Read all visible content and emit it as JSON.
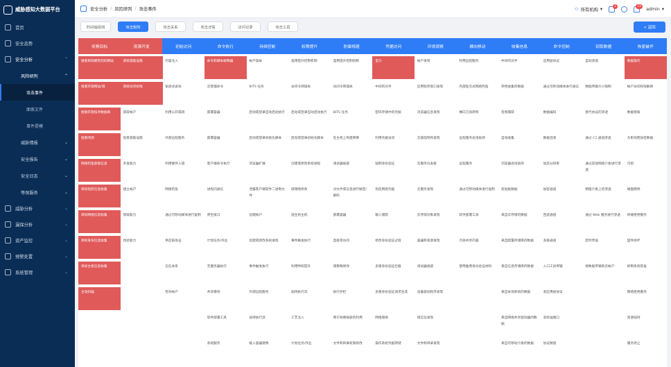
{
  "app": {
    "title": "威胁感知大数据平台"
  },
  "sidebar": {
    "items": [
      {
        "label": "首页"
      },
      {
        "label": "安全态势"
      },
      {
        "label": "安全分析"
      }
    ],
    "sub_open": {
      "label": "风险研判"
    },
    "sub_items": [
      {
        "label": "攻击事件"
      },
      {
        "label": "面索文件"
      },
      {
        "label": "事件提模"
      }
    ],
    "more": [
      {
        "label": "威胁情报"
      },
      {
        "label": "安全报告"
      },
      {
        "label": "安全日志"
      },
      {
        "label": "等保服务"
      }
    ],
    "bottom": [
      {
        "label": "威胁分析"
      },
      {
        "label": "漏保分析"
      },
      {
        "label": "资产监控"
      },
      {
        "label": "预警处置"
      },
      {
        "label": "系统管理"
      }
    ]
  },
  "topbar": {
    "breadcrumb": [
      "安全分析",
      "风险研判",
      "攻击事件"
    ],
    "org": "所有机构",
    "badge1": "2",
    "badge2": "15",
    "user": "admin"
  },
  "tabs": [
    {
      "label": "时间轴视测"
    },
    {
      "label": "攻击矩阵"
    },
    {
      "label": "攻击关系"
    },
    {
      "label": "攻击详情"
    },
    {
      "label": "访问记录"
    },
    {
      "label": "攻击工具"
    }
  ],
  "back_label": "< 返回",
  "matrix": {
    "columns": [
      {
        "header": "侦察目标",
        "hcolor": "#e05a5a",
        "cells": [
          {
            "t": "搜索目标拥有的的网站",
            "h": true
          },
          {
            "t": "搜索开放网站/域",
            "h": true
          },
          {
            "t": "搜索开放技术数据库",
            "h": true
          },
          {
            "t": "搜索闭源",
            "h": true
          },
          {
            "t": "网络钓鱼获取信息",
            "h": true
          },
          {
            "t": "目标组织信息收集",
            "h": true
          },
          {
            "t": "目标网络信息收集",
            "h": true
          },
          {
            "t": "目标身份信息收集",
            "h": true
          },
          {
            "t": "目标主机信息收集",
            "h": true
          },
          {
            "t": "主动扫描",
            "h": true
          }
        ]
      },
      {
        "header": "资源开发",
        "hcolor": "#e05a5a",
        "cells": [
          {
            "t": "获取基础设施",
            "h": true
          },
          {
            "t": "获取访问权限",
            "h": true
          },
          {
            "t": "获取帐户",
            "h": false
          },
          {
            "t": "危害基础设施",
            "h": false
          },
          {
            "t": "开发能力",
            "h": false
          },
          {
            "t": "建立帐户",
            "h": false
          },
          {
            "t": "获取能力",
            "h": false
          },
          {
            "t": "伪装能力",
            "h": false
          }
        ]
      },
      {
        "header": "初始访问",
        "hcolor": "#2e7cf6",
        "cells": [
          {
            "t": "内容注入",
            "h": false
          },
          {
            "t": "偷渡式妥协",
            "h": false
          },
          {
            "t": "利用公开漏洞",
            "h": false
          },
          {
            "t": "外部远程服务",
            "h": false
          },
          {
            "t": "利用硬件入侵",
            "h": false
          },
          {
            "t": "网络钓鱼",
            "h": false
          },
          {
            "t": "通过可移动媒体进行复制",
            "h": false
          },
          {
            "t": "供应链攻击",
            "h": false
          },
          {
            "t": "信任关系",
            "h": false
          },
          {
            "t": "有效帐户",
            "h": false
          }
        ]
      },
      {
        "header": "命令执行",
        "hcolor": "#2e7cf6",
        "cells": [
          {
            "t": "命令和脚本解释器",
            "h": true
          },
          {
            "t": "云管理命令",
            "h": false
          },
          {
            "t": "部署容器",
            "h": false
          },
          {
            "t": "部署容器",
            "h": false
          },
          {
            "t": "客户端命令执行",
            "h": false
          },
          {
            "t": "进程间通信",
            "h": false
          },
          {
            "t": "原生接口",
            "h": false
          },
          {
            "t": "计划任务/作业",
            "h": false
          },
          {
            "t": "无服务器执行",
            "h": false
          },
          {
            "t": "共享模块",
            "h": false
          },
          {
            "t": "软件部署工具",
            "h": false
          },
          {
            "t": "系统服务",
            "h": false
          }
        ]
      },
      {
        "header": "持续控制",
        "hcolor": "#2e7cf6",
        "cells": [
          {
            "t": "帐户操纵",
            "h": false
          },
          {
            "t": "BITS 任务",
            "h": false
          },
          {
            "t": "启动或登录自动启动执行",
            "h": false
          },
          {
            "t": "启动或登录初始化脚本",
            "h": false
          },
          {
            "t": "浏览器扩展",
            "h": false
          },
          {
            "t": "泄露客户端软件二进制文件",
            "h": false
          },
          {
            "t": "创建帐户",
            "h": false
          },
          {
            "t": "创建或修改系统进程",
            "h": false
          },
          {
            "t": "事件触发执行",
            "h": false
          },
          {
            "t": "外部远程服务",
            "h": false
          },
          {
            "t": "劫持执行流",
            "h": false
          },
          {
            "t": "植入容器镜像",
            "h": false
          }
        ]
      },
      {
        "header": "权限提升",
        "hcolor": "#2e7cf6",
        "cells": [
          {
            "t": "滥用提升控制机制",
            "h": false
          },
          {
            "t": "访问令牌操纵",
            "h": false
          },
          {
            "t": "启动或登录自动启动执行",
            "h": false
          },
          {
            "t": "启动或登录初始化脚本",
            "h": false
          },
          {
            "t": "创建或修改系统进程",
            "h": false
          },
          {
            "t": "域策略修改",
            "h": false
          },
          {
            "t": "逃生到主机",
            "h": false
          },
          {
            "t": "事件触发执行",
            "h": false
          },
          {
            "t": "利用特权提升",
            "h": false
          },
          {
            "t": "劫持执行流",
            "h": false
          },
          {
            "t": "工艺注入",
            "h": false
          },
          {
            "t": "计划任务/作业",
            "h": false
          }
        ]
      },
      {
        "header": "防御规避",
        "hcolor": "#2e7cf6",
        "cells": [
          {
            "t": "滥用提升控制机制",
            "h": false
          },
          {
            "t": "访问令牌操纵",
            "h": false
          },
          {
            "t": "BITS 任务",
            "h": false
          },
          {
            "t": "在主机上构建映像",
            "h": false
          },
          {
            "t": "调试器规避",
            "h": false
          },
          {
            "t": "对文件或信息进行解密/解码",
            "h": false
          },
          {
            "t": "部署容器",
            "h": false
          },
          {
            "t": "直接卷访问",
            "h": false
          },
          {
            "t": "域策略修改",
            "h": false
          },
          {
            "t": "执行护栏",
            "h": false
          },
          {
            "t": "用于防御规避的利用",
            "h": false
          },
          {
            "t": "文件和目录权限修改",
            "h": false
          }
        ]
      },
      {
        "header": "凭据访问",
        "hcolor": "#2e7cf6",
        "cells": [
          {
            "t": "蛮力",
            "h": true
          },
          {
            "t": "中间的对手",
            "h": false
          },
          {
            "t": "密码存储中的凭据",
            "h": false
          },
          {
            "t": "利用凭据访问",
            "h": false
          },
          {
            "t": "强制身份验证",
            "h": false
          },
          {
            "t": "伪造网络凭据",
            "h": false
          },
          {
            "t": "输入捕获",
            "h": false
          },
          {
            "t": "修改身份验证过程",
            "h": false
          },
          {
            "t": "多重身份验证拦截",
            "h": false
          },
          {
            "t": "多重身份验证请求生成",
            "h": false
          },
          {
            "t": "网络嗅探",
            "h": false
          },
          {
            "t": "操作系统凭据转储",
            "h": false
          }
        ]
      },
      {
        "header": "环境观察",
        "hcolor": "#2e7cf6",
        "cells": [
          {
            "t": "帐户发现",
            "h": false
          },
          {
            "t": "应用程序窗口发现",
            "h": false
          },
          {
            "t": "浏览器信息发现",
            "h": false
          },
          {
            "t": "云基础架构发现",
            "h": false
          },
          {
            "t": "云服务仪表板",
            "h": false
          },
          {
            "t": "云服务发现",
            "h": false
          },
          {
            "t": "云存储对象发现",
            "h": false
          },
          {
            "t": "容器和资源发现",
            "h": false
          },
          {
            "t": "调试器规避",
            "h": false
          },
          {
            "t": "设备驱动程序发现",
            "h": false
          },
          {
            "t": "域信任发现",
            "h": false
          },
          {
            "t": "文件和目录发现",
            "h": false
          }
        ]
      },
      {
        "header": "横向移动",
        "hcolor": "#2e7cf6",
        "cells": [
          {
            "t": "利用远程服务",
            "h": false
          },
          {
            "t": "内部鱼叉式网络钓鱼",
            "h": false
          },
          {
            "t": "横向刀具转移",
            "h": false
          },
          {
            "t": "远程服务会话劫持",
            "h": false
          },
          {
            "t": "远程服务",
            "h": false
          },
          {
            "t": "通过可移动媒体进行复制",
            "h": false
          },
          {
            "t": "软件部署工具",
            "h": false
          },
          {
            "t": "污染共享内容",
            "h": false
          },
          {
            "t": "使用备用身份验证材料",
            "h": false
          }
        ]
      },
      {
        "header": "收集信息",
        "hcolor": "#2e7cf6",
        "cells": [
          {
            "t": "中间的对手",
            "h": false
          },
          {
            "t": "存档收集的数据",
            "h": false
          },
          {
            "t": "音频捕获",
            "h": false
          },
          {
            "t": "自动收集",
            "h": false
          },
          {
            "t": "浏览器会话劫持",
            "h": false
          },
          {
            "t": "剪贴板数据",
            "h": false
          },
          {
            "t": "来自云存储的数据",
            "h": false
          },
          {
            "t": "来自配置存储库的数据",
            "h": false
          },
          {
            "t": "来自信息存储库的数据",
            "h": false
          },
          {
            "t": "来自本地系统的数据",
            "h": false
          },
          {
            "t": "来自网络共享驱动器的数据",
            "h": false
          },
          {
            "t": "来自可移动介质的数据",
            "h": false
          }
        ]
      },
      {
        "header": "命令控制",
        "hcolor": "#2e7cf6",
        "cells": [
          {
            "t": "应用层协议",
            "h": false
          },
          {
            "t": "通过可移动媒体进行通信",
            "h": false
          },
          {
            "t": "数据编码",
            "h": false
          },
          {
            "t": "数据混淆",
            "h": false
          },
          {
            "t": "动态分辨率",
            "h": false
          },
          {
            "t": "加密通道",
            "h": false
          },
          {
            "t": "回退通道",
            "h": false
          },
          {
            "t": "多级通道",
            "h": false
          },
          {
            "t": "入口工具传输",
            "h": false
          },
          {
            "t": "非应用层协议",
            "h": false
          },
          {
            "t": "非标准端口",
            "h": false
          },
          {
            "t": "协议隧道",
            "h": false
          }
        ]
      },
      {
        "header": "窃取数据",
        "hcolor": "#2e7cf6",
        "cells": [
          {
            "t": "自动渗透",
            "h": false
          },
          {
            "t": "数据传输大小限制",
            "h": false
          },
          {
            "t": "替代协议的渗透",
            "h": false
          },
          {
            "t": "通过 C2 通道渗透",
            "h": false
          },
          {
            "t": "通过其他网络介质进行渗透",
            "h": false
          },
          {
            "t": "物理介质上的渗透",
            "h": false
          },
          {
            "t": "通过 Web 服务进行渗透",
            "h": false
          },
          {
            "t": "定时传送",
            "h": false
          },
          {
            "t": "将数据传输到云帐户",
            "h": false
          }
        ]
      },
      {
        "header": "恢复破坏",
        "hcolor": "#2e7cf6",
        "cells": [
          {
            "t": "数据操作",
            "h": true
          },
          {
            "t": "帐户访问权限删除",
            "h": false
          },
          {
            "t": "数据销毁",
            "h": false
          },
          {
            "t": "为影响而加密数据",
            "h": false
          },
          {
            "t": "污损",
            "h": false
          },
          {
            "t": "磁盘擦除",
            "h": false
          },
          {
            "t": "终端拒绝服务",
            "h": false
          },
          {
            "t": "固件损坏",
            "h": false
          },
          {
            "t": "抑制系统恢复",
            "h": false
          },
          {
            "t": "网络拒绝服务",
            "h": false
          },
          {
            "t": "资源劫持",
            "h": false
          },
          {
            "t": "服务停止",
            "h": false
          }
        ]
      }
    ]
  }
}
